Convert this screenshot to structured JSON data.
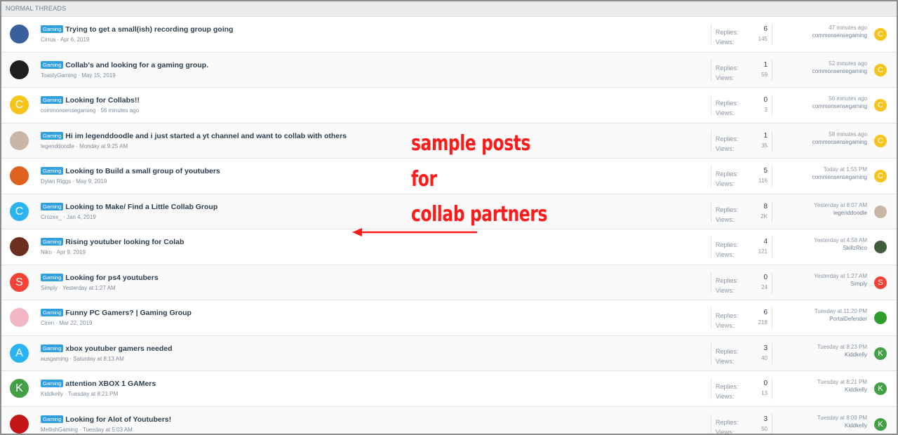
{
  "section": {
    "title": "NORMAL THREADS"
  },
  "labels": {
    "replies": "Replies:",
    "views": "Views:"
  },
  "colors": {
    "accent": "#2f9fe0",
    "annotation": "#ff1a1a",
    "avatar_yellow": "#f6c51b",
    "avatar_blue": "#2ab3f1",
    "avatar_red": "#f44336",
    "avatar_green": "#43a047"
  },
  "threads": [
    {
      "prefix": "Gaming",
      "title": "Trying to get a small(ish) recording group going",
      "meta": "Cirrus · Apr 6, 2019",
      "replies": "6",
      "views": "145",
      "last_time": "47 minutes ago",
      "last_user": "commonsensegaming",
      "avatar": {
        "icon": "image-avatar",
        "letter": "",
        "color": "#3b5f9e"
      },
      "last_avatar": {
        "icon": "letter-avatar",
        "letter": "C",
        "color": "#f6c51b"
      }
    },
    {
      "prefix": "Gaming",
      "title": "Collab's and looking for a gaming group.",
      "meta": "ToastyGaming · May 15, 2019",
      "replies": "1",
      "views": "59",
      "last_time": "52 minutes ago",
      "last_user": "commonsensegaming",
      "avatar": {
        "icon": "image-avatar",
        "letter": "",
        "color": "#1e1e1e"
      },
      "last_avatar": {
        "icon": "letter-avatar",
        "letter": "C",
        "color": "#f6c51b"
      }
    },
    {
      "prefix": "Gaming",
      "title": "Looking for Collabs!!",
      "meta": "commonsensegaming · 56 minutes ago",
      "replies": "0",
      "views": "3",
      "last_time": "56 minutes ago",
      "last_user": "commonsensegaming",
      "avatar": {
        "icon": "letter-avatar",
        "letter": "C",
        "color": "#f6c51b"
      },
      "last_avatar": {
        "icon": "letter-avatar",
        "letter": "C",
        "color": "#f6c51b"
      }
    },
    {
      "prefix": "Gaming",
      "title": "Hi im legenddoodle and i just started a yt channel and want to collab with others",
      "meta": "legenddoodle · Monday at 9:25 AM",
      "replies": "1",
      "views": "35",
      "last_time": "58 minutes ago",
      "last_user": "commonsensegaming",
      "avatar": {
        "icon": "image-avatar",
        "letter": "",
        "color": "#c8b6a6"
      },
      "last_avatar": {
        "icon": "letter-avatar",
        "letter": "C",
        "color": "#f6c51b"
      }
    },
    {
      "prefix": "Gaming",
      "title": "Looking to Build a small group of youtubers",
      "meta": "Dylan Riggs · May 9, 2019",
      "replies": "5",
      "views": "116",
      "last_time": "Today at 1:55 PM",
      "last_user": "commonsensegaming",
      "avatar": {
        "icon": "image-avatar",
        "letter": "",
        "color": "#e0601f"
      },
      "last_avatar": {
        "icon": "letter-avatar",
        "letter": "C",
        "color": "#f6c51b"
      }
    },
    {
      "prefix": "Gaming",
      "title": "Looking to Make/ Find a Little Collab Group",
      "meta": "Crozex_ · Jan 4, 2019",
      "replies": "8",
      "views": "2K",
      "last_time": "Yesterday at 8:07 AM",
      "last_user": "legenddoodle",
      "avatar": {
        "icon": "letter-avatar",
        "letter": "C",
        "color": "#2ab3f1"
      },
      "last_avatar": {
        "icon": "image-avatar",
        "letter": "",
        "color": "#c8b6a6"
      }
    },
    {
      "prefix": "Gaming",
      "title": "Rising youtuber looking for Colab",
      "meta": "Niko · Apr 9, 2019",
      "replies": "4",
      "views": "121",
      "last_time": "Yesterday at 4:58 AM",
      "last_user": "SkillzRico",
      "avatar": {
        "icon": "image-avatar",
        "letter": "",
        "color": "#6b2e1f"
      },
      "last_avatar": {
        "icon": "image-avatar",
        "letter": "",
        "color": "#3f5f3a"
      }
    },
    {
      "prefix": "Gaming",
      "title": "Looking for ps4 youtubers",
      "meta": "Simply · Yesterday at 1:27 AM",
      "replies": "0",
      "views": "24",
      "last_time": "Yesterday at 1:27 AM",
      "last_user": "Simply",
      "avatar": {
        "icon": "letter-avatar",
        "letter": "S",
        "color": "#f44336"
      },
      "last_avatar": {
        "icon": "letter-avatar",
        "letter": "S",
        "color": "#f44336"
      }
    },
    {
      "prefix": "Gaming",
      "title": "Funny PC Gamers? | Gaming Group",
      "meta": "Ciren · Mar 22, 2019",
      "replies": "6",
      "views": "218",
      "last_time": "Tuesday at 11:20 PM",
      "last_user": "PortalDefender",
      "avatar": {
        "icon": "image-avatar",
        "letter": "",
        "color": "#f2b6c4"
      },
      "last_avatar": {
        "icon": "image-avatar",
        "letter": "",
        "color": "#2e9e2e"
      }
    },
    {
      "prefix": "Gaming",
      "title": "xbox youtuber gamers needed",
      "meta": "ausgaming · Saturday at 8:13 AM",
      "replies": "3",
      "views": "40",
      "last_time": "Tuesday at 8:23 PM",
      "last_user": "Kiddkelly",
      "avatar": {
        "icon": "letter-avatar",
        "letter": "A",
        "color": "#2ab3f1"
      },
      "last_avatar": {
        "icon": "letter-avatar",
        "letter": "K",
        "color": "#43a047"
      }
    },
    {
      "prefix": "Gaming",
      "title": "attention XBOX 1 GAMers",
      "meta": "Kiddkelly · Tuesday at 8:21 PM",
      "replies": "0",
      "views": "13",
      "last_time": "Tuesday at 8:21 PM",
      "last_user": "Kiddkelly",
      "avatar": {
        "icon": "letter-avatar",
        "letter": "K",
        "color": "#43a047"
      },
      "last_avatar": {
        "icon": "letter-avatar",
        "letter": "K",
        "color": "#43a047"
      }
    },
    {
      "prefix": "Gaming",
      "title": "Looking for Alot of Youtubers!",
      "meta": "MellishGaming · Tuesday at 5:03 AM",
      "replies": "3",
      "views": "50",
      "last_time": "Tuesday at 8:09 PM",
      "last_user": "Kiddkelly",
      "avatar": {
        "icon": "image-avatar",
        "letter": "",
        "color": "#c41616"
      },
      "last_avatar": {
        "icon": "letter-avatar",
        "letter": "K",
        "color": "#43a047"
      }
    }
  ],
  "annotation": {
    "lines": [
      "sample posts",
      "for",
      "collab partners"
    ],
    "arrow": "left-arrow-icon"
  }
}
